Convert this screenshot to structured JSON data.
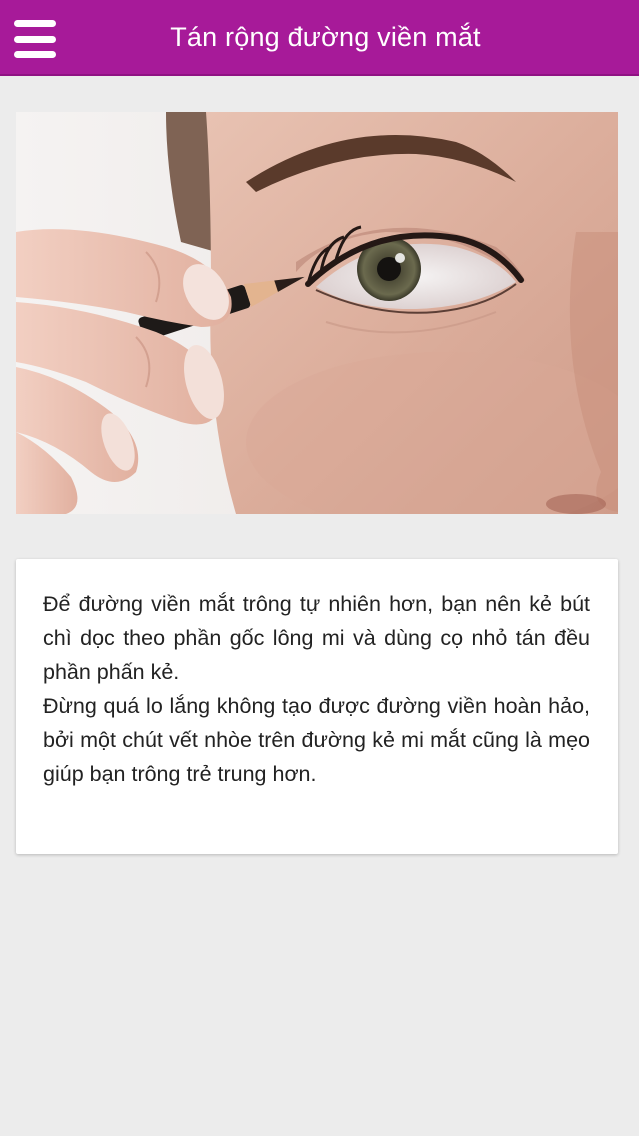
{
  "header": {
    "title": "Tán rộng đường viền mắt",
    "menu_icon": "hamburger-menu-icon",
    "background": "#a71a99"
  },
  "hero": {
    "image": "eye-liner-photo"
  },
  "content": {
    "paragraphs": [
      "Để đường viền mắt trông tự nhiên hơn, bạn nên kẻ bút chì dọc theo phần gốc lông mi và dùng cọ nhỏ tán đều phần phấn kẻ.",
      "Đừng quá lo lắng không tạo được đường viền hoàn hảo, bởi một chút vết nhòe trên đường kẻ mi mắt cũng là mẹo giúp bạn trông trẻ trung hơn."
    ]
  }
}
